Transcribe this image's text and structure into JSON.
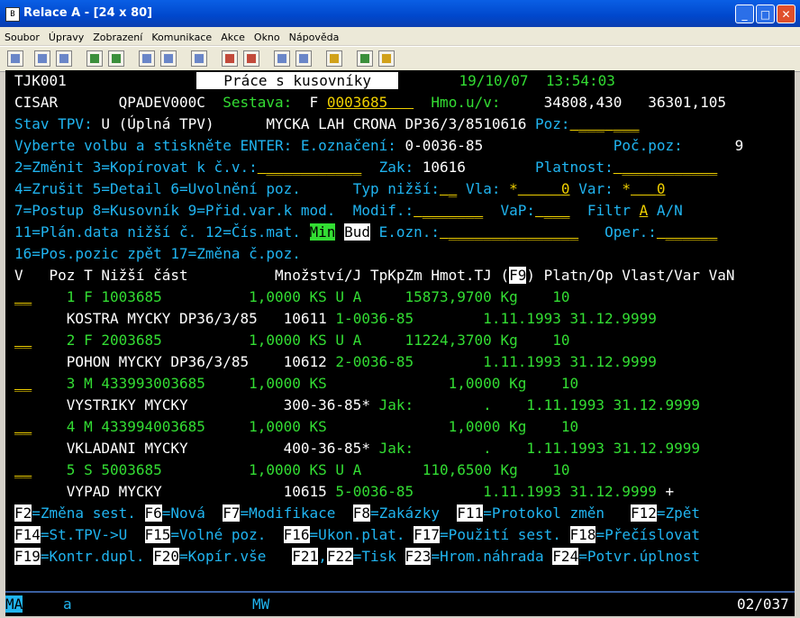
{
  "window": {
    "title": "Relace A - [24 x 80]",
    "icon_text": "B"
  },
  "menu": [
    "Soubor",
    "Úpravy",
    "Zobrazení",
    "Komunikace",
    "Akce",
    "Okno",
    "Nápověda"
  ],
  "screen": {
    "pgm": "TJK001",
    "title": "Práce s kusovníky",
    "date": "19/10/07",
    "time": "13:54:03",
    "user": "CISAR",
    "device": "QPADEV000C",
    "sestava_label": "Sestava:",
    "sestava_type": "F",
    "sestava_value": "0003685",
    "hmo_label": "Hmo.u/v:",
    "hmo_u": "34808,430",
    "hmo_v": "36301,105",
    "stav_label": "Stav TPV:",
    "stav_value": "U (Úplná TPV)",
    "desc": "MYCKA LAH CRONA DP36/3/8510616",
    "poz_label": "Poz:",
    "prompt": "Vyberte volbu a stiskněte ENTER:",
    "eozn_label": "E.označení:",
    "eozn_value": "0-0036-85",
    "pocpoz_label": "Poč.poz:",
    "pocpoz_value": "9",
    "opt_line1": "2=Změnit 3=Kopírovat k č.v.:",
    "zak_label": "Zak:",
    "zak_value": "10616",
    "platnost_label": "Platnost:",
    "opt_line2": "4=Zrušit 5=Detail 6=Uvolnění poz.",
    "typ_label": "Typ nižší:",
    "vla_label": "Vla:",
    "vla_mark": "*",
    "vla_value": "0",
    "var_label": "Var:",
    "var_mark": "*",
    "var_value": "0",
    "opt_line3": "7=Postup 8=Kusovník 9=Přid.var.k mod.",
    "modif_label": "Modif.:",
    "vap_label": "VaP:",
    "filtr_label": "Filtr",
    "filtr_value": "A",
    "filtr_an": "A/N",
    "opt_line4": "11=Plán.data nižší č. 12=Čís.mat.",
    "btn_min": "Min",
    "btn_bud": "Bud",
    "eozn2_label": "E.ozn.:",
    "oper_label": "Oper.:",
    "opt_line5": "16=Pos.pozic zpět 17=Změna č.poz.",
    "col_header": "V   Poz T Nižší část          Množství/J TpKpZm Hmot.TJ (",
    "col_f9": "F9",
    "col_header2": ") Platn/Op Vlast/Var VaN"
  },
  "rows": [
    {
      "line1": "    1 F 1003685          1,0000 KS U A     15873,9700 Kg    10",
      "line2_w": "      KOSTRA MYCKY DP36/3/85   10611 ",
      "line2_g": "1-0036-85        1.11.1993 31.12.9999"
    },
    {
      "line1": "    2 F 2003685          1,0000 KS U A     11224,3700 Kg    10",
      "line2_w": "      POHON MYCKY DP36/3/85    10612 ",
      "line2_g": "2-0036-85        1.11.1993 31.12.9999"
    },
    {
      "line1": "    3 M 433993003685     1,0000 KS              1,0000 Kg    10",
      "line2_w": "      VYSTRIKY MYCKY           300-36-85* ",
      "line2_g": "Jak:        .    1.11.1993 31.12.9999"
    },
    {
      "line1": "    4 M 433994003685     1,0000 KS              1,0000 Kg    10",
      "line2_w": "      VKLADANI MYCKY           400-36-85* ",
      "line2_g": "Jak:        .    1.11.1993 31.12.9999"
    },
    {
      "line1": "    5 S 5003685          1,0000 KS U A       110,6500 Kg    10",
      "line2_w": "      VYPAD MYCKY              10615 ",
      "line2_g": "5-0036-85        1.11.1993 31.12.9999",
      "more": " +"
    }
  ],
  "fkeys": {
    "f2": "F2",
    "f2_t": "=Změna sest. ",
    "f6": "F6",
    "f6_t": "=Nová  ",
    "f7": "F7",
    "f7_t": "=Modifikace  ",
    "f8": "F8",
    "f8_t": "=Zakázky  ",
    "f11": "F11",
    "f11_t": "=Protokol změn   ",
    "f12": "F12",
    "f12_t": "=Zpět",
    "f14": "F14",
    "f14_t": "=St.TPV->U  ",
    "f15": "F15",
    "f15_t": "=Volné poz.  ",
    "f16": "F16",
    "f16_t": "=Ukon.plat. ",
    "f17": "F17",
    "f17_t": "=Použití sest. ",
    "f18": "F18",
    "f18_t": "=Přečíslovat",
    "f19": "F19",
    "f19_t": "=Kontr.dupl. ",
    "f20": "F20",
    "f20_t": "=Kopír.vše   ",
    "f21": "F21",
    "f21_sep": ",",
    "f22": "F22",
    "f22_t": "=Tisk ",
    "f23": "F23",
    "f23_t": "=Hrom.náhrada ",
    "f24": "F24",
    "f24_t": "=Potvr.úplnost"
  },
  "statusbar": {
    "mode": "MA",
    "cursor_char": "a",
    "mw": "MW",
    "pos": "02/037"
  }
}
